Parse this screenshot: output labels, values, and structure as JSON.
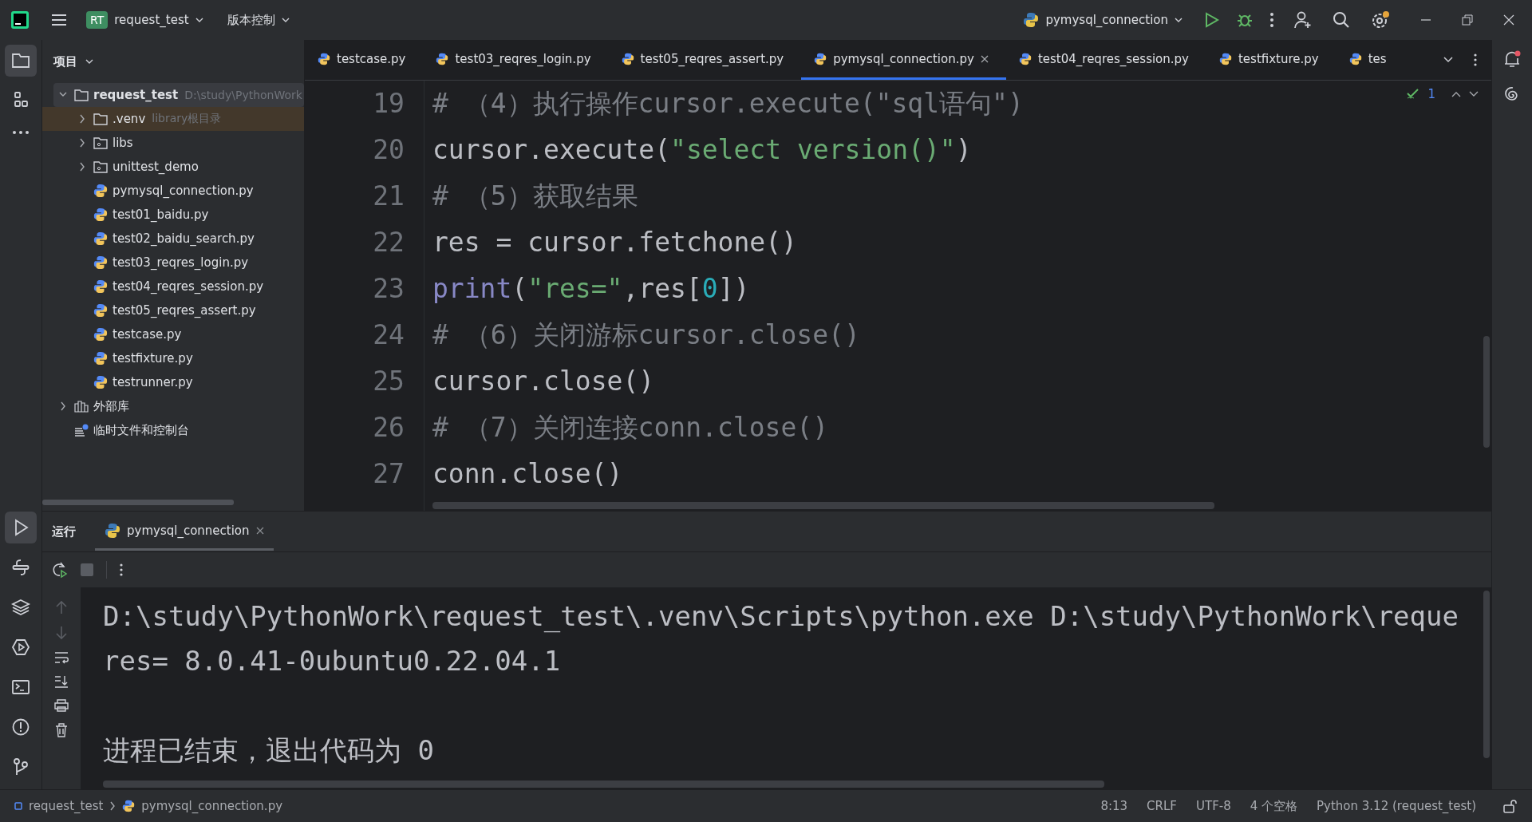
{
  "title_bar": {
    "project_badge": "RT",
    "project": "request_test",
    "vcs": "版本控制",
    "run_config": "pymysql_connection"
  },
  "project_panel": {
    "title": "项目",
    "tree": [
      {
        "label": "request_test",
        "hint": "D:\\study\\PythonWork",
        "kind": "project",
        "expanded": true,
        "selected": false,
        "children": [
          {
            "label": ".venv",
            "hint": "library根目录",
            "kind": "folder",
            "expanded": false,
            "selected": true
          },
          {
            "label": "libs",
            "kind": "module",
            "expanded": false,
            "selected": false
          },
          {
            "label": "unittest_demo",
            "kind": "module",
            "expanded": false,
            "selected": false
          },
          {
            "label": "pymysql_connection.py",
            "kind": "python",
            "selected": false
          },
          {
            "label": "test01_baidu.py",
            "kind": "python",
            "selected": false
          },
          {
            "label": "test02_baidu_search.py",
            "kind": "python",
            "selected": false
          },
          {
            "label": "test03_reqres_login.py",
            "kind": "python",
            "selected": false
          },
          {
            "label": "test04_reqres_session.py",
            "kind": "python",
            "selected": false
          },
          {
            "label": "test05_reqres_assert.py",
            "kind": "python",
            "selected": false
          },
          {
            "label": "testcase.py",
            "kind": "python",
            "selected": false
          },
          {
            "label": "testfixture.py",
            "kind": "python",
            "selected": false
          },
          {
            "label": "testrunner.py",
            "kind": "python",
            "selected": false
          }
        ]
      },
      {
        "label": "外部库",
        "kind": "library",
        "expanded": false,
        "selected": false
      },
      {
        "label": "临时文件和控制台",
        "kind": "scratch",
        "selected": false
      }
    ]
  },
  "editor_tabs": [
    {
      "label": "testcase.py",
      "selected": false
    },
    {
      "label": "test03_reqres_login.py",
      "selected": false
    },
    {
      "label": "test05_reqres_assert.py",
      "selected": false
    },
    {
      "label": "pymysql_connection.py",
      "selected": true
    },
    {
      "label": "test04_reqres_session.py",
      "selected": false
    },
    {
      "label": "testfixture.py",
      "selected": false
    },
    {
      "label": "tes",
      "selected": false
    }
  ],
  "inspection": {
    "count": "1"
  },
  "code": [
    {
      "number": "19",
      "tokens": [
        {
          "kind": "comment",
          "text": "# （4）执行操作cursor.execute(\"sql语句\")"
        }
      ]
    },
    {
      "number": "20",
      "tokens": [
        {
          "kind": "plain",
          "text": "cursor.execute("
        },
        {
          "kind": "string",
          "text": "\"select version()\""
        },
        {
          "kind": "plain",
          "text": ")"
        }
      ]
    },
    {
      "number": "21",
      "tokens": [
        {
          "kind": "comment",
          "text": "# （5）获取结果"
        }
      ]
    },
    {
      "number": "22",
      "tokens": [
        {
          "kind": "plain",
          "text": "res = cursor.fetchone()"
        }
      ]
    },
    {
      "number": "23",
      "tokens": [
        {
          "kind": "builtin",
          "text": "print"
        },
        {
          "kind": "plain",
          "text": "("
        },
        {
          "kind": "string",
          "text": "\"res=\""
        },
        {
          "kind": "plain",
          "text": ",res["
        },
        {
          "kind": "number",
          "text": "0"
        },
        {
          "kind": "plain",
          "text": "])"
        }
      ]
    },
    {
      "number": "24",
      "tokens": [
        {
          "kind": "comment",
          "text": "# （6）关闭游标cursor.close()"
        }
      ]
    },
    {
      "number": "25",
      "tokens": [
        {
          "kind": "plain",
          "text": "cursor.close()"
        }
      ]
    },
    {
      "number": "26",
      "tokens": [
        {
          "kind": "comment",
          "text": "# （7）关闭连接conn.close()"
        }
      ]
    },
    {
      "number": "27",
      "tokens": [
        {
          "kind": "plain",
          "text": "conn.close()"
        }
      ]
    }
  ],
  "run_panel": {
    "title": "运行",
    "tab": "pymysql_connection",
    "console": [
      {
        "kind": "command",
        "text": "D:\\study\\PythonWork\\request_test\\.venv\\Scripts\\python.exe D:\\study\\PythonWork\\reque"
      },
      {
        "kind": "output",
        "text": "res= 8.0.41-0ubuntu0.22.04.1"
      },
      {
        "kind": "exit",
        "text": "进程已结束，退出代码为 0"
      }
    ]
  },
  "status_bar": {
    "breadcrumbs": [
      "request_test",
      "pymysql_connection.py"
    ],
    "position": "8:13",
    "line_separator": "CRLF",
    "encoding": "UTF-8",
    "indent": "4 个空格",
    "interpreter": "Python 3.12 (request_test)"
  }
}
